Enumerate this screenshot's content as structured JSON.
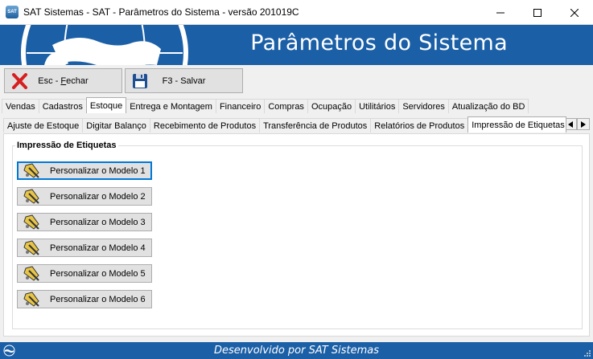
{
  "window": {
    "title": "SAT Sistemas - SAT - Parâmetros do Sistema - versão 201019C",
    "icon_text": "SAT"
  },
  "banner": {
    "title": "Parâmetros do Sistema"
  },
  "toolbar": {
    "close": {
      "label_pre": "Esc - ",
      "label_underlined": "F",
      "label_post": "echar",
      "icon": "red-x-icon"
    },
    "save": {
      "label": "F3 - Salvar",
      "icon": "floppy-disk-icon"
    }
  },
  "main_tabs": [
    "Vendas",
    "Cadastros",
    "Estoque",
    "Entrega e Montagem",
    "Financeiro",
    "Compras",
    "Ocupação",
    "Utilitários",
    "Servidores",
    "Atualização do BD"
  ],
  "main_tab_active": "Estoque",
  "sub_tabs": [
    "Ajuste de Estoque",
    "Digitar Balanço",
    "Recebimento de Produtos",
    "Transferência de Produtos",
    "Relatórios de Produtos",
    "Impressão de Etiquetas"
  ],
  "sub_tab_active": "Impressão de Etiquetas",
  "group": {
    "title": "Impressão de Etiquetas",
    "buttons": [
      "Personalizar o Modelo 1",
      "Personalizar o Modelo 2",
      "Personalizar o Modelo 3",
      "Personalizar o Modelo 4",
      "Personalizar o Modelo 5",
      "Personalizar o Modelo 6"
    ]
  },
  "footer": {
    "text": "Desenvolvido por SAT Sistemas"
  },
  "colors": {
    "brand_blue": "#1b5fa6",
    "close_red": "#d61f1f"
  }
}
